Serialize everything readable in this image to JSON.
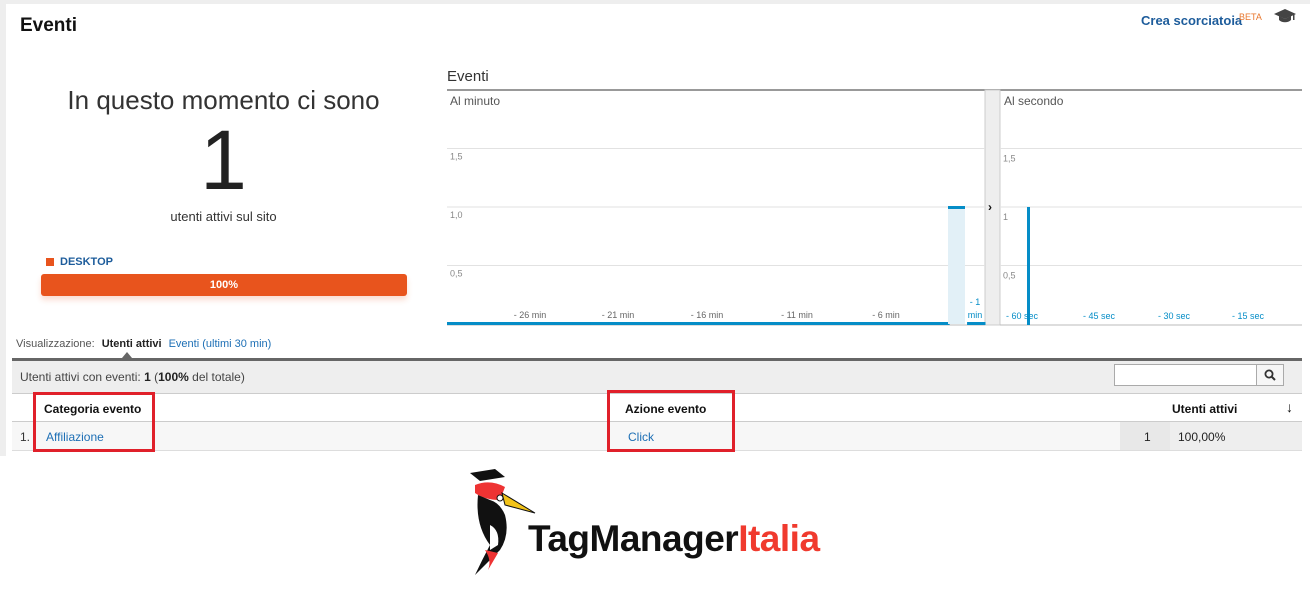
{
  "header": {
    "title": "Eventi",
    "shortcut_label": "Crea scorciatoia",
    "beta_label": "BETA",
    "icon": "graduation-cap-icon"
  },
  "summary": {
    "intro": "In questo momento ci sono",
    "active_users": "1",
    "subtitle": "utenti attivi sul sito",
    "device_label": "DESKTOP",
    "device_percent_label": "100%",
    "device_percent": 100,
    "device_color": "#e8541d"
  },
  "chart_data": [
    {
      "type": "bar",
      "title": "Eventi",
      "subtitle": "Al minuto",
      "ylim": [
        0,
        1.5
      ],
      "y_ticks": [
        "0,5",
        "1,0",
        "1,5"
      ],
      "x_ticks": [
        "- 26 min",
        "- 21 min",
        "- 16 min",
        "- 11 min",
        "- 6 min",
        "- 1 min"
      ],
      "x": [
        -30,
        -29,
        -28,
        -27,
        -26,
        -25,
        -24,
        -23,
        -22,
        -21,
        -20,
        -19,
        -18,
        -17,
        -16,
        -15,
        -14,
        -13,
        -12,
        -11,
        -10,
        -9,
        -8,
        -7,
        -6,
        -5,
        -4,
        -3,
        -2,
        -1
      ],
      "values": [
        0,
        0,
        0,
        0,
        0,
        0,
        0,
        0,
        0,
        0,
        0,
        0,
        0,
        0,
        0,
        0,
        0,
        0,
        0,
        0,
        0,
        0,
        0,
        0,
        0,
        0,
        0,
        0,
        1,
        0
      ],
      "color": "#058dc7",
      "grid": true
    },
    {
      "type": "bar",
      "subtitle": "Al secondo",
      "ylim": [
        0,
        1.5
      ],
      "y_ticks": [
        "0,5",
        "1",
        "1,5"
      ],
      "x_ticks": [
        "- 60 sec",
        "- 45 sec",
        "- 30 sec",
        "- 15 sec"
      ],
      "spikes": [
        {
          "x": -60,
          "value": 1
        }
      ],
      "color": "#058dc7",
      "grid": true
    }
  ],
  "view": {
    "label": "Visualizzazione:",
    "active": "Utenti attivi",
    "other": "Eventi (ultimi 30 min)"
  },
  "table": {
    "summary_prefix": "Utenti attivi con eventi:",
    "summary_count": "1",
    "summary_open": "(",
    "summary_pct": "100%",
    "summary_suffix": "del totale)",
    "search_placeholder": "",
    "columns": [
      "Categoria evento",
      "Azione evento",
      "Utenti attivi"
    ],
    "rows": [
      {
        "index": "1.",
        "category": "Affiliazione",
        "action": "Click",
        "users": "1",
        "percent": "100,00%"
      }
    ]
  },
  "logo": {
    "text_black": "TagManager",
    "text_red": "Italia"
  }
}
